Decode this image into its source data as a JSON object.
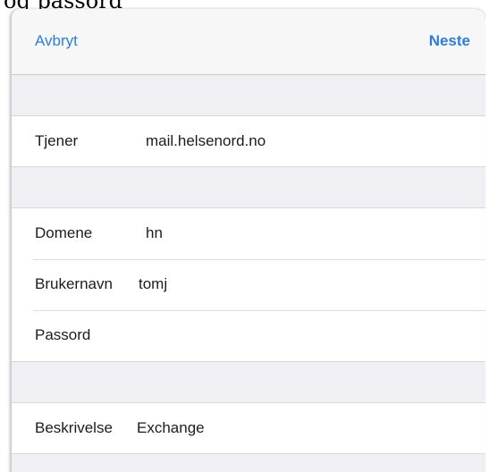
{
  "document": {
    "caption_fragment": "og passord"
  },
  "navbar": {
    "cancel_label": "Avbryt",
    "next_label": "Neste"
  },
  "server_group": {
    "rows": [
      {
        "label": "Tjener",
        "value": "mail.helsenord.no"
      }
    ]
  },
  "account_group": {
    "rows": [
      {
        "label": "Domene",
        "value": "hn"
      },
      {
        "label": "Brukernavn",
        "value": "tomj"
      },
      {
        "label": "Passord",
        "value": ""
      }
    ]
  },
  "description_group": {
    "rows": [
      {
        "label": "Beskrivelse",
        "value": "Exchange"
      }
    ]
  },
  "colors": {
    "accent": "#2b7de1",
    "grouped_background": "#efeff4",
    "navbar_background": "#f7f7f8",
    "separator": "#c8c7cc"
  }
}
